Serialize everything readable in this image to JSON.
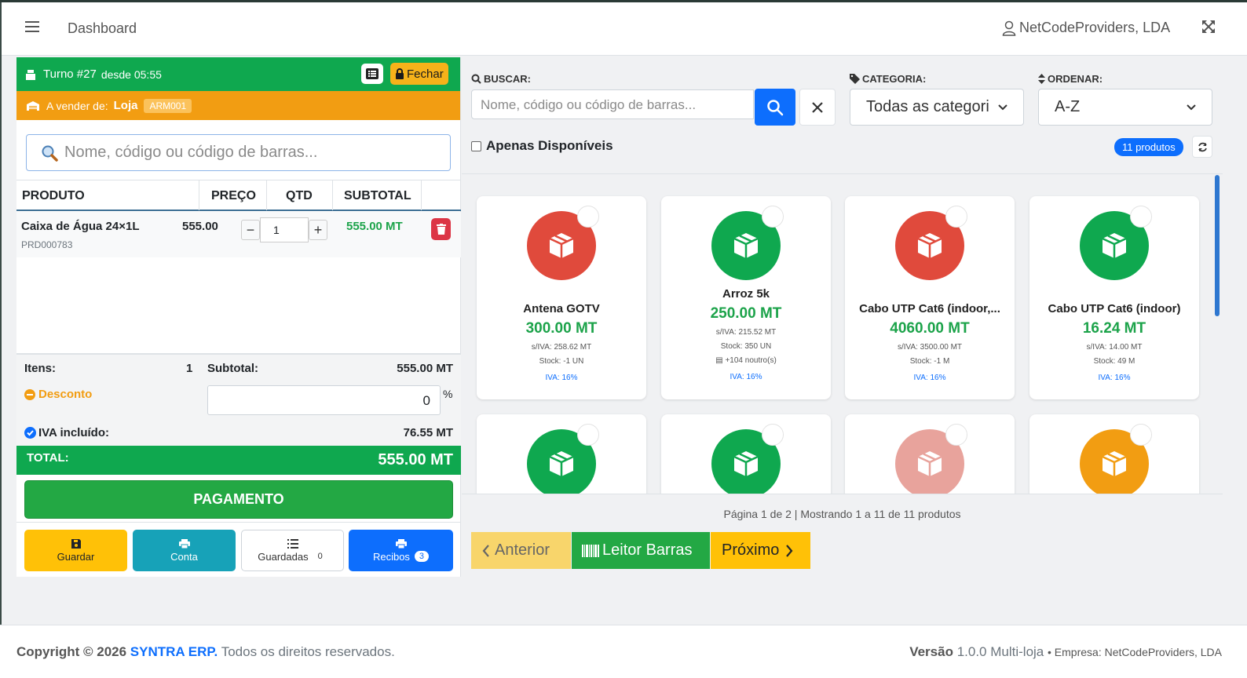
{
  "header": {
    "title": "Dashboard",
    "user": "NetCodeProviders, LDA"
  },
  "turno": {
    "label": "Turno #27",
    "since": "desde 05:55",
    "close_label": "Fechar"
  },
  "seller": {
    "prefix": "A vender de:",
    "store": "Loja",
    "warehouse": "ARM001"
  },
  "cart_search": {
    "placeholder": "Nome, código ou código de barras..."
  },
  "cart_table": {
    "headers": [
      "PRODUTO",
      "PREÇO",
      "QTD",
      "SUBTOTAL"
    ],
    "rows": [
      {
        "name": "Caixa de Água 24×1L",
        "code": "PRD000783",
        "price": "555.00",
        "qty": "1",
        "subtotal": "555.00 MT"
      }
    ]
  },
  "summary": {
    "items_label": "Itens:",
    "items_value": "1",
    "subtotal_label": "Subtotal:",
    "subtotal_value": "555.00 MT",
    "discount_label": "Desconto",
    "discount_value": "0",
    "discount_unit": "%",
    "vat_label": "IVA incluído:",
    "vat_value": "76.55 MT",
    "total_label": "TOTAL:",
    "total_value": "555.00 MT"
  },
  "payment_label": "PAGAMENTO",
  "actions": {
    "save": "Guardar",
    "account": "Conta",
    "saved": "Guardadas",
    "saved_count": "0",
    "receipts": "Recibos",
    "receipts_count": "3"
  },
  "filters": {
    "search_label": "BUSCAR:",
    "search_placeholder": "Nome, código ou código de barras...",
    "category_label": "CATEGORIA:",
    "category_value": "Todas as categori",
    "order_label": "ORDENAR:",
    "order_value": "A-Z",
    "available_only": "Apenas Disponíveis",
    "product_count": "11 produtos"
  },
  "products": [
    {
      "name": "Antena GOTV",
      "price": "300.00 MT",
      "net": "s/IVA: 258.62 MT",
      "stock": "Stock: -1 UN",
      "extra": "",
      "vat": "IVA: 16%",
      "color": "#e04a3c"
    },
    {
      "name": "Arroz 5k",
      "price": "250.00 MT",
      "net": "s/IVA: 215.52 MT",
      "stock": "Stock: 350 UN",
      "extra": "+104 noutro(s)",
      "vat": "IVA: 16%",
      "color": "#0fa84f"
    },
    {
      "name": "Cabo UTP Cat6 (indoor,...",
      "price": "4060.00 MT",
      "net": "s/IVA: 3500.00 MT",
      "stock": "Stock: -1 M",
      "extra": "",
      "vat": "IVA: 16%",
      "color": "#e04a3c"
    },
    {
      "name": "Cabo UTP Cat6 (indoor)",
      "price": "16.24 MT",
      "net": "s/IVA: 14.00 MT",
      "stock": "Stock: 49 M",
      "extra": "",
      "vat": "IVA: 16%",
      "color": "#0fa84f"
    },
    {
      "name": "",
      "price": "",
      "net": "",
      "stock": "",
      "extra": "",
      "vat": "",
      "color": "#0fa84f"
    },
    {
      "name": "",
      "price": "",
      "net": "",
      "stock": "",
      "extra": "",
      "vat": "",
      "color": "#0fa84f"
    },
    {
      "name": "",
      "price": "",
      "net": "",
      "stock": "",
      "extra": "",
      "vat": "",
      "color": "#e8a39c"
    },
    {
      "name": "",
      "price": "",
      "net": "",
      "stock": "",
      "extra": "",
      "vat": "",
      "color": "#f29d12"
    }
  ],
  "pagination": {
    "info": "Página 1 de 2 | Mostrando 1 a 11 de 11 produtos",
    "prev": "Anterior",
    "barcode": "Leitor Barras",
    "next": "Próximo"
  },
  "footer": {
    "copyright_prefix": "Copyright © 2026",
    "brand": "SYNTRA ERP.",
    "rights": "Todos os direitos reservados.",
    "version_label": "Versão",
    "version_value": "1.0.0 Multi-loja",
    "company": "Empresa: NetCodeProviders, LDA"
  },
  "colors": {
    "green": "#0fa84f",
    "orange": "#f29d12",
    "blue": "#0d6efd",
    "red": "#dc3545",
    "yellow": "#ffc107",
    "teal": "#17a2b8"
  }
}
